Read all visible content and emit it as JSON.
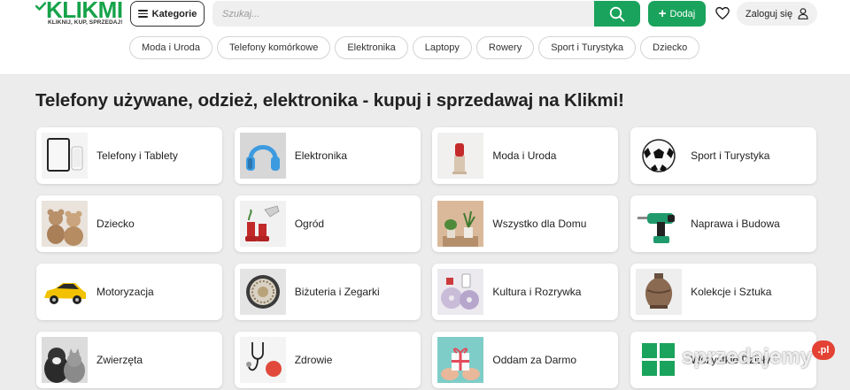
{
  "brand": {
    "logo_text": "KLIKMI",
    "tagline": "KLIKNIJ, KUP, SPRZEDAJ!",
    "accent_color": "#1aa35c"
  },
  "header": {
    "categories_label": "Kategorie",
    "search_placeholder": "Szukaj...",
    "search_icon": "search-icon",
    "add_label": "Dodaj",
    "favorites_icon": "heart-icon",
    "login_label": "Zaloguj się",
    "login_icon": "user-icon"
  },
  "quick_categories": [
    "Moda i Uroda",
    "Telefony komórkowe",
    "Elektronika",
    "Laptopy",
    "Rowery",
    "Sport i Turystyka",
    "Dziecko"
  ],
  "main": {
    "headline": "Telefony używane, odzież, elektronika - kupuj i sprzedawaj na Klikmi!"
  },
  "categories": [
    {
      "label": "Telefony i Tablety",
      "image": "phones-tablets-image"
    },
    {
      "label": "Elektronika",
      "image": "headphones-image"
    },
    {
      "label": "Moda i Uroda",
      "image": "lipstick-image"
    },
    {
      "label": "Sport i Turystyka",
      "image": "football-image"
    },
    {
      "label": "Dziecko",
      "image": "teddy-bears-image"
    },
    {
      "label": "Ogród",
      "image": "garden-boots-image"
    },
    {
      "label": "Wszystko dla Domu",
      "image": "houseplants-image"
    },
    {
      "label": "Naprawa i Budowa",
      "image": "power-drill-image"
    },
    {
      "label": "Motoryzacja",
      "image": "yellow-car-image"
    },
    {
      "label": "Biżuteria i Zegarki",
      "image": "watch-image"
    },
    {
      "label": "Kultura i Rozrywka",
      "image": "cds-image"
    },
    {
      "label": "Kolekcje i Sztuka",
      "image": "clay-vase-image"
    },
    {
      "label": "Zwierzęta",
      "image": "cat-dog-image"
    },
    {
      "label": "Zdrowie",
      "image": "stethoscope-image"
    },
    {
      "label": "Oddam za Darmo",
      "image": "gift-image"
    },
    {
      "label": "Wszystkie Działy",
      "image": "all-categories-image"
    }
  ],
  "watermark": {
    "text": "sprzedajemy",
    "badge": ".pl"
  }
}
